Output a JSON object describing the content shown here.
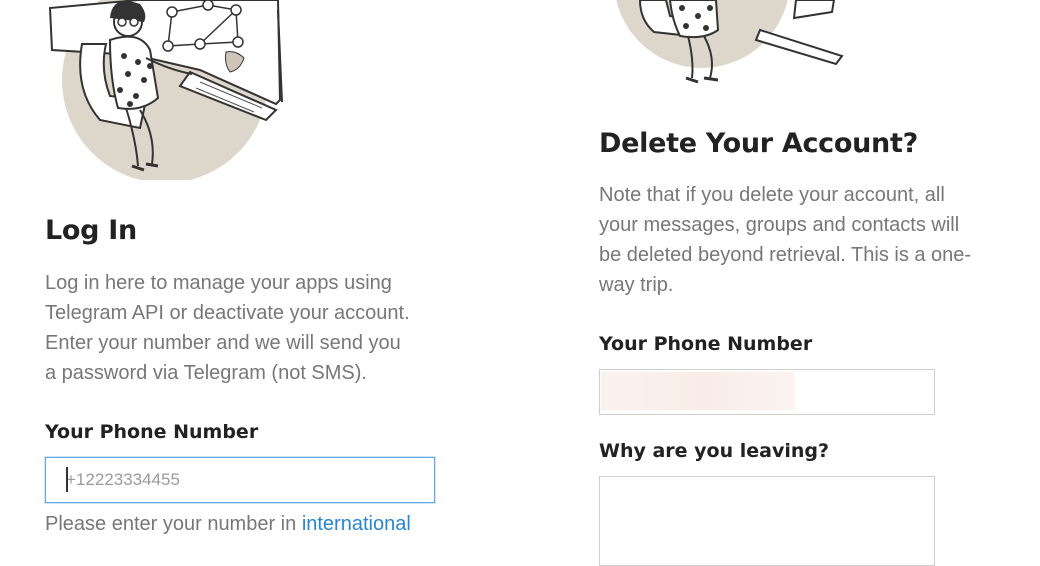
{
  "login": {
    "title": "Log In",
    "description_lines": [
      "Log in here to manage your apps using",
      "Telegram API or deactivate your account.",
      "Enter your number and we will send you",
      "a password via Telegram (not SMS)."
    ],
    "phone_label": "Your Phone Number",
    "phone_placeholder": "+12223334455",
    "hint_text": "Please enter your number in ",
    "hint_link": "international"
  },
  "delete": {
    "title": "Delete Your Account?",
    "description_lines": [
      "Note that if you delete your account, all",
      "your messages, groups and contacts will",
      "be deleted beyond retrieval. This is a one-",
      "way trip."
    ],
    "phone_label": "Your Phone Number",
    "reason_label": "Why are you leaving?"
  },
  "colors": {
    "link": "#2a86d1",
    "focus_border": "#62a8ea",
    "illustration_bg": "#ddd7cb"
  }
}
